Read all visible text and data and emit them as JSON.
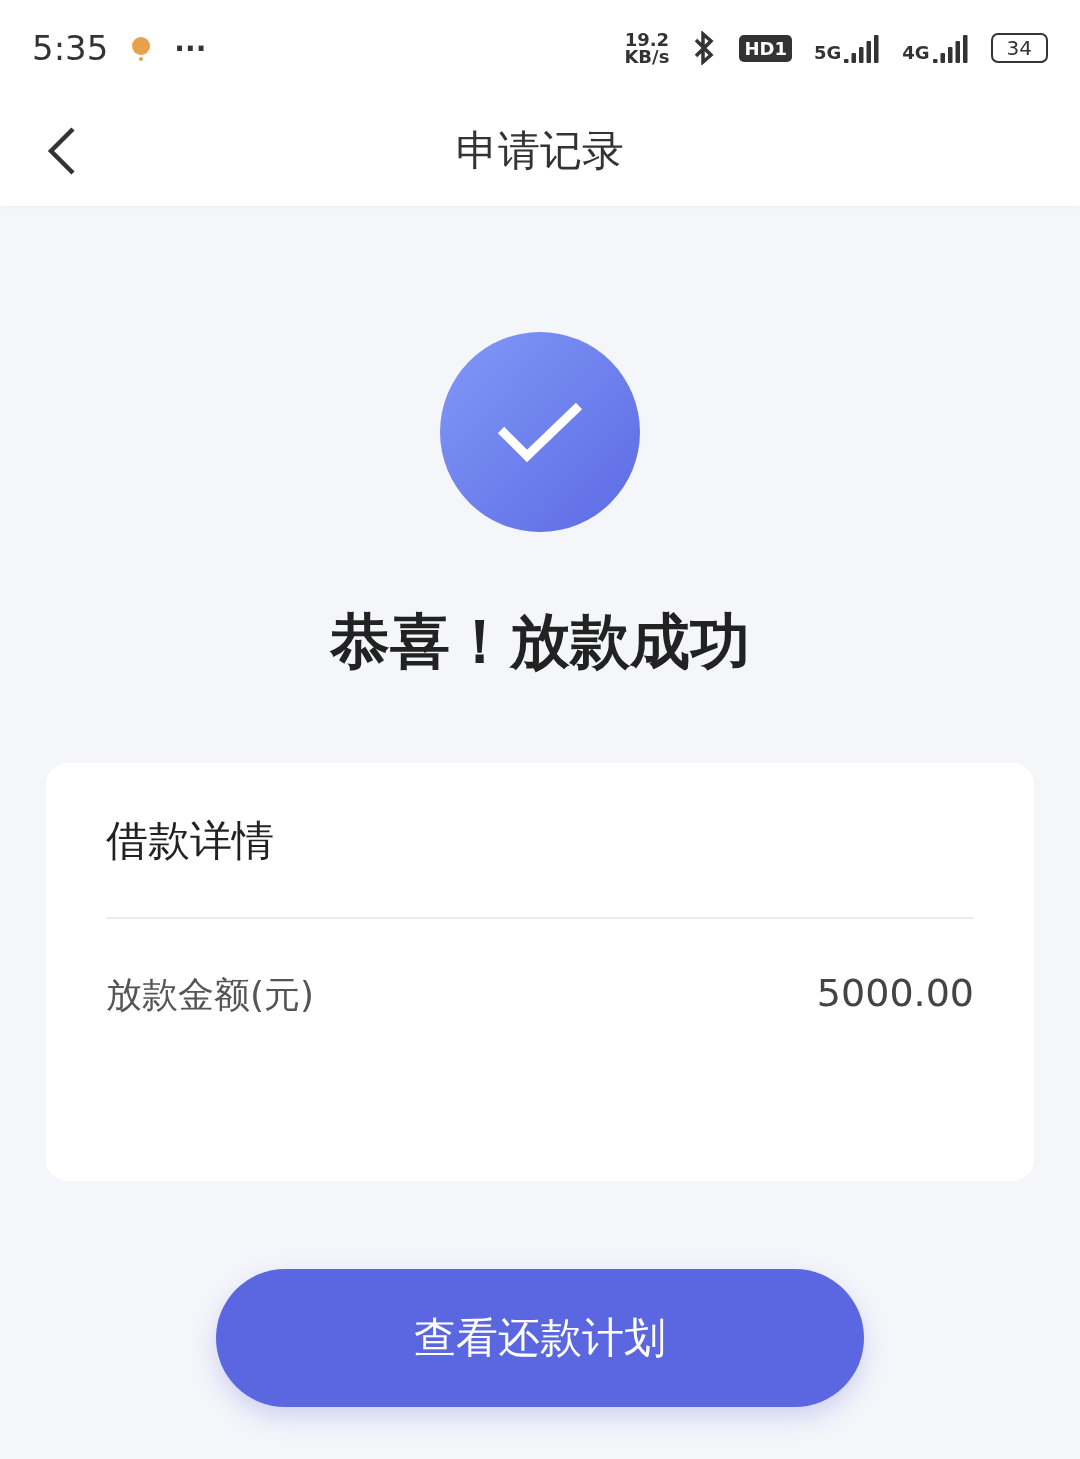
{
  "status_bar": {
    "time": "5:35",
    "more": "···",
    "speed_value": "19.2",
    "speed_unit": "KB/s",
    "hd_badge": "HD1",
    "network_1": "5G",
    "network_2": "4G",
    "battery": "34"
  },
  "header": {
    "title": "申请记录"
  },
  "result": {
    "title": "恭喜！放款成功"
  },
  "details": {
    "title": "借款详情",
    "rows": [
      {
        "label": "放款金额(元)",
        "value": "5000.00"
      }
    ]
  },
  "button": {
    "label": "查看还款计划"
  }
}
